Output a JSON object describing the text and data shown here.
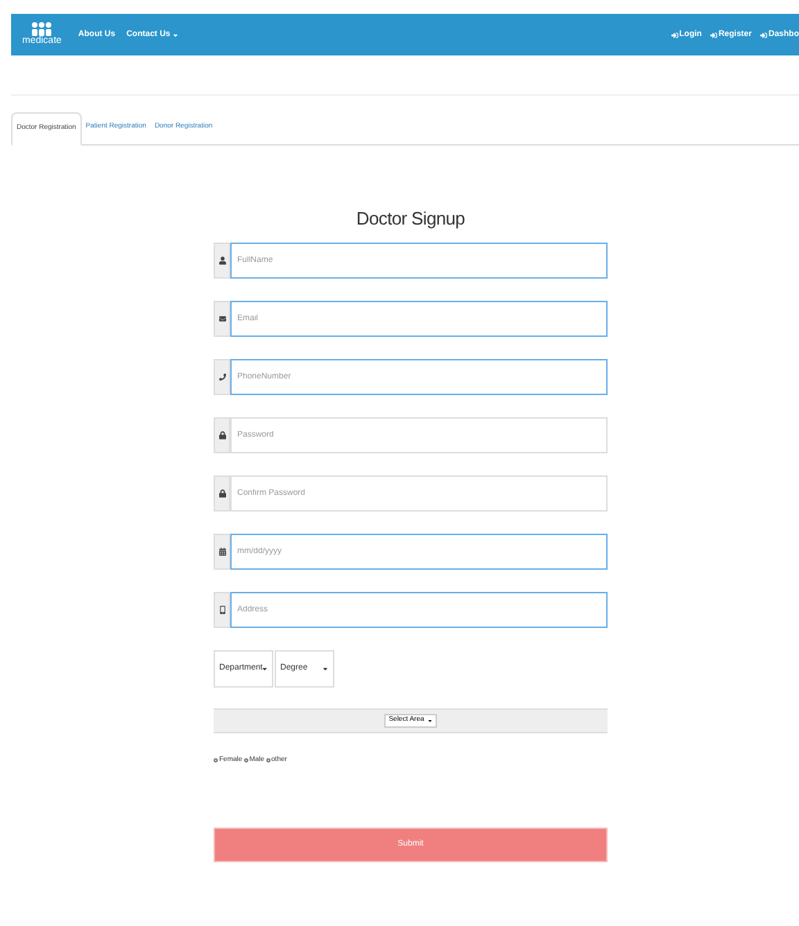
{
  "navbar": {
    "brand": "medicate",
    "links": [
      {
        "label": "About Us",
        "dropdown": false
      },
      {
        "label": "Contact Us",
        "dropdown": true
      }
    ],
    "right_links": [
      "Login",
      "Register",
      "Dashbo"
    ]
  },
  "tabs": [
    {
      "label": "Doctor Registration",
      "selected": true
    },
    {
      "label": "Patient Registration",
      "selected": false
    },
    {
      "label": "Donor Registration",
      "selected": false
    }
  ],
  "form": {
    "title": "Doctor Signup",
    "fields": [
      {
        "kind": "name",
        "placeholder": "FullName",
        "highlighted": true
      },
      {
        "kind": "email",
        "placeholder": "Email",
        "highlighted": true
      },
      {
        "kind": "phone",
        "placeholder": "PhoneNumber",
        "highlighted": true
      },
      {
        "kind": "password",
        "placeholder": "Password",
        "highlighted": false
      },
      {
        "kind": "password",
        "placeholder": "Confirm Password",
        "highlighted": false
      },
      {
        "kind": "date",
        "placeholder": "mm/dd/yyyy",
        "highlighted": true
      },
      {
        "kind": "address",
        "placeholder": "Address",
        "highlighted": true
      }
    ],
    "selects": [
      {
        "value": "Department"
      },
      {
        "value": "Degree"
      }
    ],
    "area_select": "Select Area",
    "gender_options": [
      {
        "label": "Female",
        "selected": false
      },
      {
        "label": "Male",
        "selected": false
      },
      {
        "label": "other",
        "selected": false
      }
    ],
    "submit": "Submit"
  }
}
